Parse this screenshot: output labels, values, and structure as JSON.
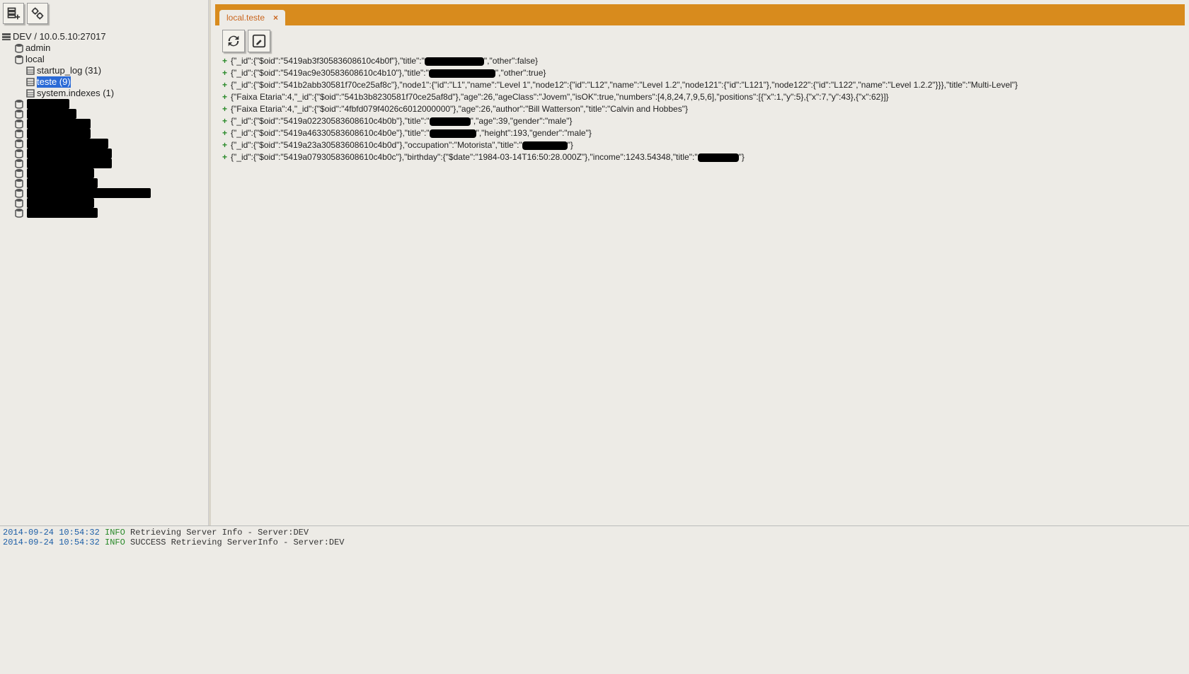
{
  "sidebar": {
    "server_label": "DEV / 10.0.5.10:27017",
    "databases": [
      {
        "name": "admin"
      },
      {
        "name": "local",
        "collections": [
          {
            "label": "startup_log (31)",
            "selected": false
          },
          {
            "label": "teste (9)",
            "selected": true
          },
          {
            "label": "system.indexes (1)",
            "selected": false
          }
        ]
      }
    ],
    "redacted_db_widths": [
      60,
      70,
      90,
      90,
      115,
      120,
      120,
      95,
      100,
      175,
      95,
      100
    ]
  },
  "tab": {
    "label": "local.teste",
    "close": "×"
  },
  "docs": [
    {
      "segments": [
        {
          "t": "{\"_id\":{\"$oid\":\"5419ab3f30583608610c4b0f\"},\"title\":\""
        },
        {
          "r": 84
        },
        {
          "t": "\",\"other\":false}"
        }
      ]
    },
    {
      "segments": [
        {
          "t": "{\"_id\":{\"$oid\":\"5419ac9e30583608610c4b10\"},\"title\":\""
        },
        {
          "r": 94
        },
        {
          "t": "\",\"other\":true}"
        }
      ]
    },
    {
      "segments": [
        {
          "t": "{\"_id\":{\"$oid\":\"541b2abb30581f70ce25af8c\"},\"node1\":{\"id\":\"L1\",\"name\":\"Level 1\",\"node12\":{\"id\":\"L12\",\"name\":\"Level 1.2\",\"node121\":{\"id\":\"L121\"},\"node122\":{\"id\":\"L122\",\"name\":\"Level 1.2.2\"}}},\"title\":\"Multi-Level\"}"
        }
      ]
    },
    {
      "segments": [
        {
          "t": "{\"Faixa Etaria\":4,\"_id\":{\"$oid\":\"541b3b8230581f70ce25af8d\"},\"age\":26,\"ageClass\":\"Jovem\",\"isOK\":true,\"numbers\":[4,8,24,7,9,5,6],\"positions\":[{\"x\":1,\"y\":5},{\"x\":7,\"y\":43},{\"x\":62}]}"
        }
      ]
    },
    {
      "segments": [
        {
          "t": "{\"Faixa Etaria\":4,\"_id\":{\"$oid\":\"4fbfd079f4026c6012000000\"},\"age\":26,\"author\":\"Bill Watterson\",\"title\":\"Calvin and Hobbes\"}"
        }
      ]
    },
    {
      "segments": [
        {
          "t": "{\"_id\":{\"$oid\":\"5419a02230583608610c4b0b\"},\"title\":\""
        },
        {
          "r": 58
        },
        {
          "t": "\",\"age\":39,\"gender\":\"male\"}"
        }
      ]
    },
    {
      "segments": [
        {
          "t": "{\"_id\":{\"$oid\":\"5419a46330583608610c4b0e\"},\"title\":\""
        },
        {
          "r": 66
        },
        {
          "t": "\",\"height\":193,\"gender\":\"male\"}"
        }
      ]
    },
    {
      "segments": [
        {
          "t": "{\"_id\":{\"$oid\":\"5419a23a30583608610c4b0d\"},\"occupation\":\"Motorista\",\"title\":\""
        },
        {
          "r": 64
        },
        {
          "t": "\"}"
        }
      ]
    },
    {
      "segments": [
        {
          "t": "{\"_id\":{\"$oid\":\"5419a07930583608610c4b0c\"},\"birthday\":{\"$date\":\"1984-03-14T16:50:28.000Z\"},\"income\":1243.54348,\"title\":\""
        },
        {
          "r": 58
        },
        {
          "t": "\"}"
        }
      ]
    }
  ],
  "log": [
    {
      "ts": "2014-09-24 10:54:32",
      "level": "INFO",
      "msg": "Retrieving Server Info - Server:DEV"
    },
    {
      "ts": "2014-09-24 10:54:32",
      "level": "INFO",
      "msg": "SUCCESS Retrieving ServerInfo - Server:DEV"
    }
  ]
}
